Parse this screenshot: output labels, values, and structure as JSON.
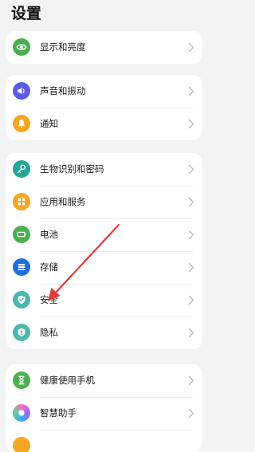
{
  "header": {
    "title": "设置"
  },
  "groups": [
    {
      "items": [
        {
          "label": "显示和亮度",
          "icon": "eye-icon",
          "color": "#4caf50"
        }
      ]
    },
    {
      "items": [
        {
          "label": "声音和振动",
          "icon": "volume-icon",
          "color": "#5b5be6"
        },
        {
          "label": "通知",
          "icon": "bell-icon",
          "color": "#f5a623"
        }
      ]
    },
    {
      "items": [
        {
          "label": "生物识别和密码",
          "icon": "key-icon",
          "color": "#26a69a"
        },
        {
          "label": "应用和服务",
          "icon": "apps-grid-icon",
          "color": "#f5a623"
        },
        {
          "label": "电池",
          "icon": "battery-icon",
          "color": "#4caf50"
        },
        {
          "label": "存储",
          "icon": "storage-icon",
          "color": "#1e6fd9"
        },
        {
          "label": "安全",
          "icon": "shield-check-icon",
          "color": "#4db6ac"
        },
        {
          "label": "隐私",
          "icon": "privacy-shield-icon",
          "color": "#4db6ac"
        }
      ]
    },
    {
      "items": [
        {
          "label": "健康使用手机",
          "icon": "hourglass-icon",
          "color": "#4caf50"
        },
        {
          "label": "智慧助手",
          "icon": "assistant-icon",
          "color": "#8e6cf0"
        }
      ]
    }
  ],
  "annotation": {
    "color": "#e53935"
  }
}
